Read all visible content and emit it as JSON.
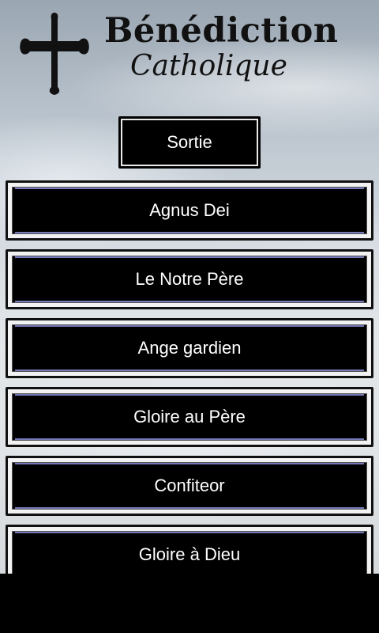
{
  "header": {
    "title": "Bénédiction",
    "subtitle": "Catholique",
    "logo_icon": "cross-icon"
  },
  "exit_button": {
    "label": "Sortie"
  },
  "menu": {
    "items": [
      {
        "label": "Agnus Dei"
      },
      {
        "label": "Le Notre Père"
      },
      {
        "label": "Ange gardien"
      },
      {
        "label": "Gloire au Père"
      },
      {
        "label": "Confiteor"
      },
      {
        "label": "Gloire à Dieu"
      }
    ]
  },
  "colors": {
    "button_bg": "#000000",
    "button_text": "#ffffff",
    "button_inner_line": "#8a8fd8"
  }
}
